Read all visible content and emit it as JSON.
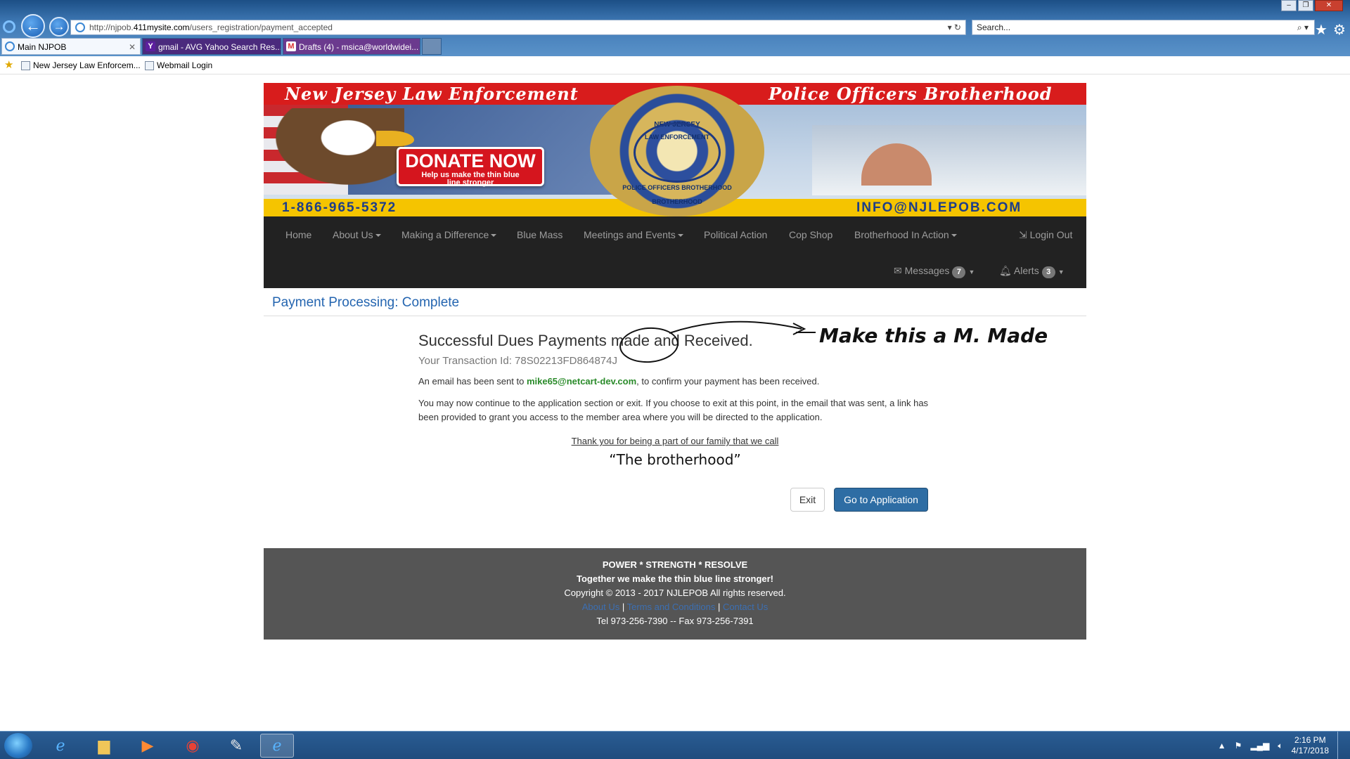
{
  "browser": {
    "url_prefix": "http://njpob.",
    "url_domain": "411mysite.com",
    "url_path": "/users_registration/payment_accepted",
    "search_placeholder": "Search...",
    "tabs": [
      {
        "label": "Main NJPOB",
        "active": true
      },
      {
        "label": "gmail - AVG Yahoo Search Res...",
        "active": false
      },
      {
        "label": "Drafts (4) - msica@worldwidei...",
        "active": false
      }
    ],
    "favorites": [
      {
        "label": "New Jersey Law Enforcem..."
      },
      {
        "label": "Webmail Login"
      }
    ]
  },
  "banner": {
    "title_left": "New Jersey Law Enforcement",
    "title_right": "Police Officers Brotherhood",
    "donate_big": "DONATE NOW",
    "donate_small": "Help us make the thin blue line stronger",
    "phone": "1-866-965-5372",
    "email": "INFO@NJLEPOB.COM",
    "badge_lines": [
      "NEW JERSEY",
      "LAW ENFORCEMENT",
      "POLICE OFFICERS BROTHERHOOD",
      "BROTHERHOOD"
    ]
  },
  "nav": {
    "items": [
      {
        "label": "Home"
      },
      {
        "label": "About Us"
      },
      {
        "label": "Making a Difference"
      },
      {
        "label": "Blue Mass"
      },
      {
        "label": "Meetings and Events"
      },
      {
        "label": "Political Action"
      },
      {
        "label": "Cop Shop"
      },
      {
        "label": "Brotherhood In Action"
      }
    ],
    "logout": "Login Out",
    "messages_label": "Messages",
    "messages_count": "7",
    "alerts_label": "Alerts",
    "alerts_count": "3"
  },
  "page": {
    "heading": "Payment Processing: Complete",
    "success_title": "Successful Dues Payments made and Received.",
    "transaction_label": "Your Transaction Id:",
    "transaction_id": "78S02213FD864874J",
    "email_pre": "An email has been sent to ",
    "email_address": "mike65@netcart-dev.com",
    "email_post": ", to confirm your payment has been received.",
    "continue_text": "You may now continue to the application section or exit. If you choose to exit at this point, in the email that was sent, a link has been provided to grant you access to the member area where you will be directed to the application.",
    "thanks": "Thank you for being a part of our family that we call",
    "brotherhood": "“The brotherhood”",
    "exit_button": "Exit",
    "app_button": "Go to Application"
  },
  "annotation": {
    "text": "Make this a M. Made"
  },
  "footer": {
    "line1": "POWER * STRENGTH * RESOLVE",
    "line2": "Together we make the thin blue line stronger!",
    "line3": "Copyright © 2013 - 2017 NJLEPOB   All rights reserved.",
    "links": [
      "About Us",
      "Terms and Conditions",
      "Contact Us"
    ],
    "line5": "Tel 973-256-7390 -- Fax 973-256-7391"
  },
  "taskbar": {
    "time": "2:16 PM",
    "date": "4/17/2018"
  },
  "colors": {
    "nav_bg": "#222222",
    "primary_button": "#2e6da4",
    "heading_blue": "#2465b0",
    "email_green": "#2a8b2a",
    "footer_bg": "#555555",
    "banner_red": "#d81c1c",
    "banner_yellow": "#f5c400"
  },
  "icons": [
    "back-arrow-icon",
    "forward-arrow-icon",
    "ie-page-icon",
    "refresh-icon",
    "search-icon",
    "home-star-icon",
    "gear-icon",
    "envelope-icon",
    "bell-icon",
    "logout-icon",
    "windows-start-icon"
  ]
}
